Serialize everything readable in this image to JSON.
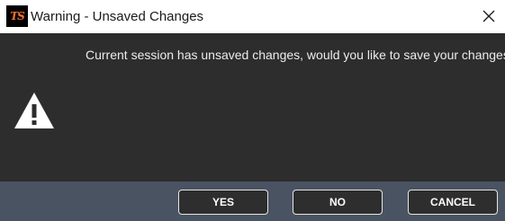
{
  "window": {
    "title": "Warning - Unsaved Changes",
    "app_icon_text": "TS",
    "close_glyph": "✕"
  },
  "dialog": {
    "message": "Current session has unsaved changes, would you like to save your changes?",
    "icon": "warning-triangle-icon"
  },
  "buttons": {
    "yes_label": "YES",
    "no_label": "NO",
    "cancel_label": "CANCEL"
  },
  "colors": {
    "body_bg": "#2d2d2d",
    "footer_bg": "#4a5362",
    "button_bg": "#2e2e2e",
    "accent_icon": "#f07030"
  }
}
